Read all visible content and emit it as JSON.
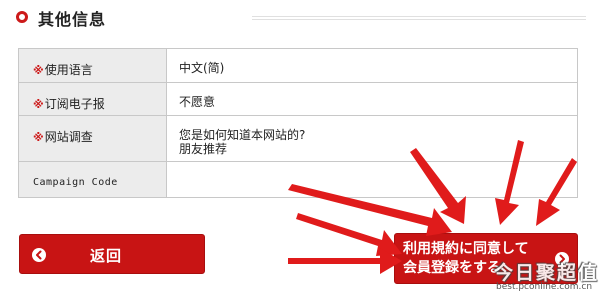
{
  "section": {
    "title": "其他信息"
  },
  "form": {
    "required_mark": "※",
    "rows": [
      {
        "label": "使用语言",
        "required": true,
        "value_lines": [
          "中文(简)"
        ]
      },
      {
        "label": "订阅电子报",
        "required": true,
        "value_lines": [
          "不愿意"
        ]
      },
      {
        "label": "网站调查",
        "required": true,
        "value_lines": [
          "您是如何知道本网站的?",
          "朋友推荐"
        ]
      },
      {
        "label": "Campaign Code",
        "required": false,
        "value_lines": [
          ""
        ]
      }
    ]
  },
  "buttons": {
    "back_label": "返回",
    "agree_label_line1": "利用規約に同意して",
    "agree_label_line2": "会員登録をする"
  },
  "watermark": {
    "logo": "今日聚超值",
    "url": "best.pconline.com.cn"
  },
  "colors": {
    "accent": "#cc1a1a",
    "button_bg": "#c81414",
    "label_bg": "#ececec",
    "border": "#c8c8c8"
  },
  "icons": {
    "section": "ring-icon",
    "back": "chevron-left-icon",
    "agree": "chevron-right-icon",
    "annotation": "red-arrow-annotations"
  }
}
